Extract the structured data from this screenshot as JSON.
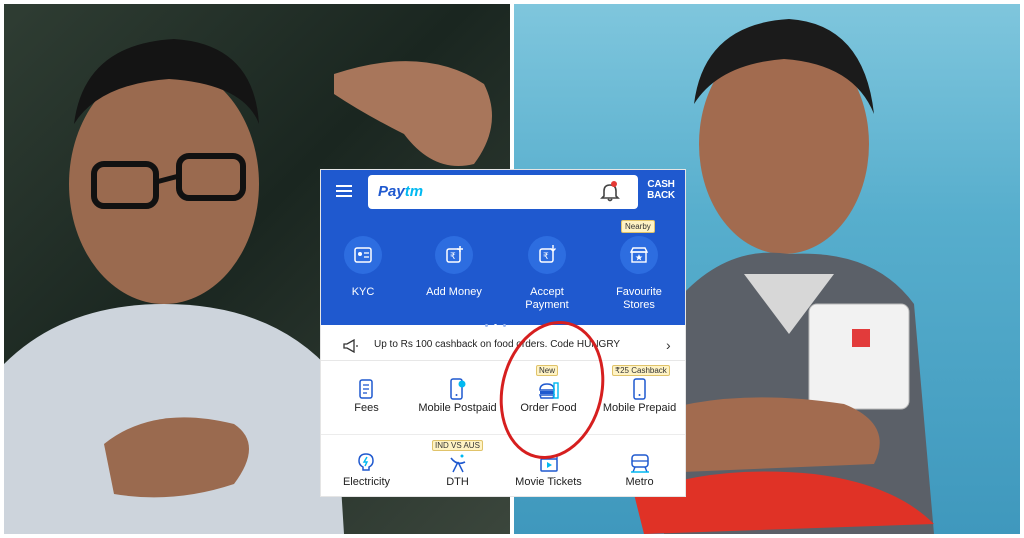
{
  "header": {
    "logo_main": "Pay",
    "logo_accent": "tm",
    "cashback_line1": "CASH",
    "cashback_line2": "BACK",
    "nearby_badge": "Nearby"
  },
  "quick_actions": [
    {
      "label": "KYC",
      "icon": "kyc-icon"
    },
    {
      "label": "Add Money",
      "icon": "add-money-icon"
    },
    {
      "label": "Accept Payment",
      "icon": "accept-payment-icon"
    },
    {
      "label": "Favourite Stores",
      "icon": "store-icon"
    }
  ],
  "promo": {
    "text": "Up to Rs 100 cashback on food orders. Code HUNGRY",
    "icon": "megaphone-icon",
    "arrow": "›"
  },
  "services": [
    {
      "label": "Fees",
      "icon": "fees-icon"
    },
    {
      "label": "Mobile Postpaid",
      "icon": "mobile-postpaid-icon"
    },
    {
      "label": "Order Food",
      "icon": "food-icon",
      "badge": "New"
    },
    {
      "label": "Mobile Prepaid",
      "icon": "mobile-prepaid-icon",
      "badge": "₹25 Cashback"
    },
    {
      "label": "Electricity",
      "icon": "electricity-icon"
    },
    {
      "label": "DTH",
      "icon": "dth-icon",
      "badge": "IND VS AUS"
    },
    {
      "label": "Movie Tickets",
      "icon": "movie-icon"
    },
    {
      "label": "Metro",
      "icon": "metro-icon"
    }
  ],
  "colors": {
    "brand_blue": "#1f59cf",
    "accent_cyan": "#00b9f1",
    "annotation_red": "#d61f1f"
  }
}
